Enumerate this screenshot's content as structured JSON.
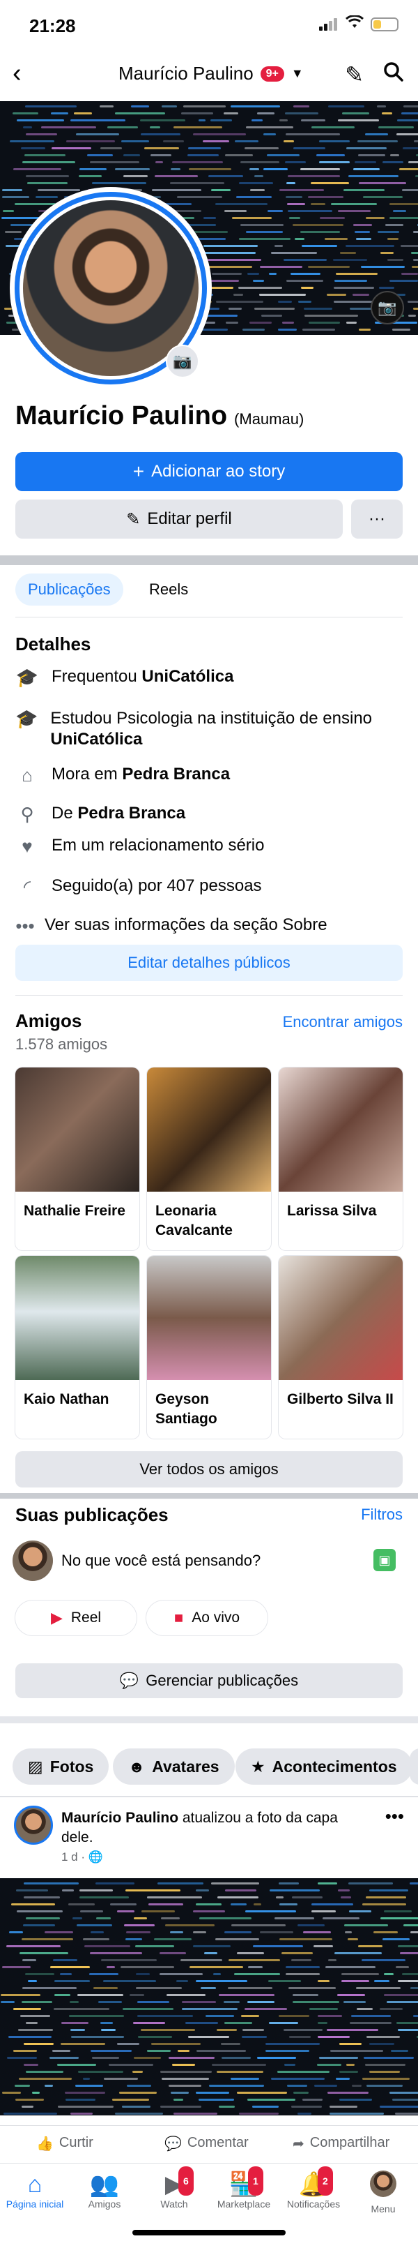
{
  "status_bar": {
    "time": "21:28"
  },
  "nav": {
    "back_icon": "chevron-left-icon",
    "title": "Maurício Paulino",
    "badge": "9+",
    "edit_icon": "pencil-icon",
    "search_icon": "search-icon"
  },
  "profile": {
    "name": "Maurício Paulino",
    "nickname": "(Maumau)",
    "add_story_label": "Adicionar ao story",
    "edit_profile_label": "Editar perfil",
    "more_label": "···"
  },
  "tabs": [
    {
      "label": "Publicações"
    },
    {
      "label": "Reels"
    }
  ],
  "details": {
    "title": "Detalhes",
    "items": [
      {
        "prefix": "Frequentou ",
        "strong": "UniCatólica",
        "icon": "graduation-cap-icon"
      },
      {
        "prefix": "Estudou Psicologia na instituição de ensino ",
        "strong": "UniCatólica",
        "icon": "graduation-cap-icon"
      },
      {
        "prefix": "Mora em ",
        "strong": "Pedra Branca",
        "icon": "home-icon"
      },
      {
        "prefix": "De ",
        "strong": "Pedra Branca",
        "icon": "location-pin-icon"
      },
      {
        "prefix": "Em um relacionamento sério",
        "strong": "",
        "icon": "heart-icon"
      },
      {
        "prefix": "Seguido(a) por 407 pessoas",
        "strong": "",
        "icon": "rss-icon"
      },
      {
        "prefix": "Ver suas informações da seção Sobre",
        "strong": "",
        "icon": "more-dots-icon"
      }
    ],
    "edit_public_label": "Editar detalhes públicos"
  },
  "friends": {
    "title": "Amigos",
    "count": "1.578 amigos",
    "find_label": "Encontrar amigos",
    "items": [
      {
        "name": "Nathalie Freire"
      },
      {
        "name": "Leonaria Cavalcante"
      },
      {
        "name": "Larissa Silva"
      },
      {
        "name": "Kaio Nathan"
      },
      {
        "name": "Geyson Santiago"
      },
      {
        "name": "Gilberto Silva II"
      }
    ],
    "see_all_label": "Ver todos os amigos"
  },
  "posts": {
    "title": "Suas publicações",
    "filters_label": "Filtros",
    "composer_placeholder": "No que você está pensando?",
    "reel_label": "Reel",
    "live_label": "Ao vivo",
    "manage_label": "Gerenciar publicações"
  },
  "chips": [
    {
      "label": "Fotos"
    },
    {
      "label": "Avatares"
    },
    {
      "label": "Acontecimentos"
    }
  ],
  "post": {
    "author": "Maurício Paulino",
    "action": " atualizou a foto da capa dele.",
    "time": "1 d · ",
    "like_label": "Curtir",
    "comment_label": "Comentar",
    "share_label": "Compartilhar"
  },
  "bottom_nav": [
    {
      "label": "Página inicial",
      "icon": "home-icon",
      "badge": ""
    },
    {
      "label": "Amigos",
      "icon": "friends-icon",
      "badge": ""
    },
    {
      "label": "Watch",
      "icon": "video-icon",
      "badge": "6"
    },
    {
      "label": "Marketplace",
      "icon": "store-icon",
      "badge": "1"
    },
    {
      "label": "Notificações",
      "icon": "bell-icon",
      "badge": "2"
    },
    {
      "label": "Menu",
      "icon": "avatar-icon",
      "badge": ""
    }
  ],
  "colors": {
    "brand": "#1877f2",
    "badge": "#e41e3f",
    "battery": "#f7c948"
  }
}
